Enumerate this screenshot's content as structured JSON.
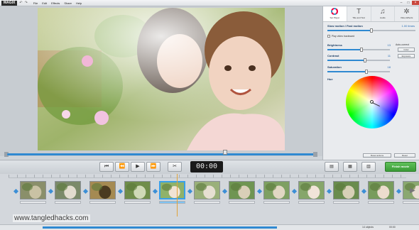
{
  "app": {
    "logo": "MAGIX",
    "menu": [
      "File",
      "Edit",
      "Effects",
      "Share",
      "Help"
    ]
  },
  "panel": {
    "tabs": [
      {
        "label": "Set Player",
        "icon": "color-wheel-icon"
      },
      {
        "label": "Title and Text",
        "icon": "text-icon"
      },
      {
        "label": "Audio",
        "icon": "audio-icon"
      },
      {
        "label": "Video Effects",
        "icon": "effects-icon"
      }
    ],
    "speed": {
      "title": "Slow motion / Fast motion",
      "value": "1.00 times",
      "level": 0.5
    },
    "play_backward": "Play video backward",
    "brightness": {
      "label": "Brightness",
      "value": "13",
      "level": 0.55
    },
    "contrast": {
      "label": "Contrast",
      "value": "11",
      "level": 0.6
    },
    "saturation": {
      "label": "Saturation",
      "value": "18",
      "level": 0.62
    },
    "auto_correct": {
      "label": "Auto-correct",
      "color_btn": "Color",
      "exposure_btn": "Exposure"
    },
    "hue": {
      "label": "Hue"
    },
    "reset_actions": "Reset actions",
    "reset": "Reset"
  },
  "transport": {
    "timecode": "00:00",
    "finish_label": "Finish movie"
  },
  "timeline": {
    "clips": 12,
    "selected_clip": 5
  },
  "watermark": "www.tangledhacks.com",
  "status": {
    "left": "14 objects",
    "right": "00:00"
  },
  "colors": {
    "accent": "#2f89d1",
    "finish": "#4aae45"
  }
}
